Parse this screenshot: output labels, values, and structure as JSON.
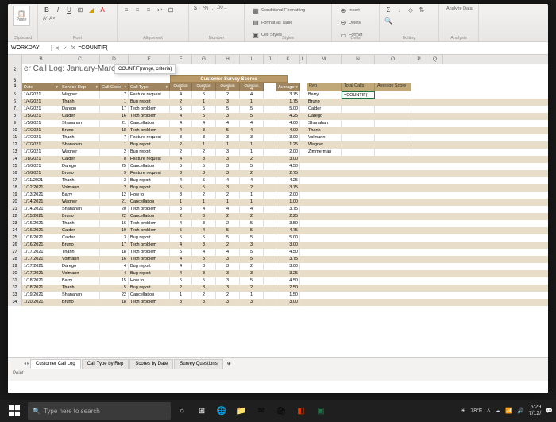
{
  "namebox": "WORKDAY",
  "formula": "=COUNTIF(",
  "tooltip": "COUNTIF(range, criteria)",
  "title": "er Call Log: January-March",
  "ribbon": {
    "groups": {
      "clipboard": "Clipboard",
      "font": "Font",
      "alignment": "Alignment",
      "number": "Number",
      "styles": "Styles",
      "cells": "Cells",
      "editing": "Editing",
      "analysis": "Analysis"
    },
    "paste": "Paste",
    "cond_fmt": "Conditional Formatting",
    "fmt_table": "Format as Table",
    "cell_styles": "Cell Styles",
    "insert": "Insert",
    "delete": "Delete",
    "format": "Format",
    "analyze": "Analyze Data"
  },
  "colheaders": [
    "B",
    "C",
    "D",
    "E",
    "F",
    "G",
    "H",
    "I",
    "J",
    "K",
    "L",
    "M",
    "N",
    "O",
    "P",
    "Q"
  ],
  "survey_header": "Customer Survey Scores",
  "table_headers": {
    "date": "Date",
    "rep": "Service Rep",
    "code": "Call Code",
    "type": "Call Type",
    "q": "Question",
    "q1": "1",
    "q2": "2",
    "q3": "3",
    "q4": "4",
    "avg": "Average"
  },
  "right_headers": {
    "rep": "Rep",
    "total": "Total Calls",
    "avg": "Average Score"
  },
  "right_formula": "=COUNTIF(",
  "reps": [
    "Barry",
    "Bruno",
    "Calder",
    "Darego",
    "Shanahan",
    "Thanh",
    "Volmann",
    "Wagner",
    "Zimmerman"
  ],
  "rows": [
    {
      "n": 5,
      "d": "1/4/2021",
      "r": "Wagner",
      "c": "7",
      "t": "Feature request",
      "q": [
        4,
        5,
        2,
        4
      ],
      "a": "3.75"
    },
    {
      "n": 6,
      "d": "1/4/2021",
      "r": "Thanh",
      "c": "1",
      "t": "Bug report",
      "q": [
        2,
        1,
        3,
        1
      ],
      "a": "1.75"
    },
    {
      "n": 7,
      "d": "1/4/2021",
      "r": "Darego",
      "c": "17",
      "t": "Tech problem",
      "q": [
        5,
        5,
        5,
        5
      ],
      "a": "5.00"
    },
    {
      "n": 8,
      "d": "1/5/2021",
      "r": "Calder",
      "c": "16",
      "t": "Tech problem",
      "q": [
        4,
        5,
        3,
        5
      ],
      "a": "4.25"
    },
    {
      "n": 9,
      "d": "1/5/2021",
      "r": "Shanahan",
      "c": "21",
      "t": "Cancellation",
      "q": [
        4,
        4,
        4,
        4
      ],
      "a": "4.00"
    },
    {
      "n": 10,
      "d": "1/7/2021",
      "r": "Bruno",
      "c": "18",
      "t": "Tech problem",
      "q": [
        4,
        3,
        5,
        4
      ],
      "a": "4.00"
    },
    {
      "n": 11,
      "d": "1/7/2021",
      "r": "Thanh",
      "c": "7",
      "t": "Feature request",
      "q": [
        3,
        3,
        3,
        3
      ],
      "a": "3.00"
    },
    {
      "n": 12,
      "d": "1/7/2021",
      "r": "Shanahan",
      "c": "1",
      "t": "Bug report",
      "q": [
        2,
        1,
        1,
        1
      ],
      "a": "1.25"
    },
    {
      "n": 13,
      "d": "1/7/2021",
      "r": "Wagner",
      "c": "2",
      "t": "Bug report",
      "q": [
        2,
        2,
        3,
        1
      ],
      "a": "2.00"
    },
    {
      "n": 14,
      "d": "1/8/2021",
      "r": "Calder",
      "c": "8",
      "t": "Feature request",
      "q": [
        4,
        3,
        3,
        2
      ],
      "a": "3.00"
    },
    {
      "n": 15,
      "d": "1/9/2021",
      "r": "Darego",
      "c": "25",
      "t": "Cancellation",
      "q": [
        5,
        5,
        3,
        5
      ],
      "a": "4.50"
    },
    {
      "n": 16,
      "d": "1/9/2021",
      "r": "Bruno",
      "c": "9",
      "t": "Feature request",
      "q": [
        3,
        3,
        3,
        2
      ],
      "a": "2.75"
    },
    {
      "n": 17,
      "d": "1/11/2021",
      "r": "Thanh",
      "c": "3",
      "t": "Bug report",
      "q": [
        4,
        5,
        4,
        4
      ],
      "a": "4.25"
    },
    {
      "n": 18,
      "d": "1/12/2021",
      "r": "Volmann",
      "c": "2",
      "t": "Bug report",
      "q": [
        5,
        5,
        3,
        2
      ],
      "a": "3.75"
    },
    {
      "n": 19,
      "d": "1/13/2021",
      "r": "Barry",
      "c": "12",
      "t": "How to",
      "q": [
        3,
        2,
        2,
        1
      ],
      "a": "2.00"
    },
    {
      "n": 20,
      "d": "1/14/2021",
      "r": "Wagner",
      "c": "21",
      "t": "Cancellation",
      "q": [
        1,
        1,
        1,
        1
      ],
      "a": "1.00"
    },
    {
      "n": 21,
      "d": "1/14/2021",
      "r": "Shanahan",
      "c": "20",
      "t": "Tech problem",
      "q": [
        3,
        4,
        4,
        4
      ],
      "a": "3.75"
    },
    {
      "n": 22,
      "d": "1/15/2021",
      "r": "Bruno",
      "c": "22",
      "t": "Cancellation",
      "q": [
        2,
        3,
        2,
        2
      ],
      "a": "2.25"
    },
    {
      "n": 23,
      "d": "1/16/2021",
      "r": "Thanh",
      "c": "16",
      "t": "Tech problem",
      "q": [
        4,
        3,
        2,
        5
      ],
      "a": "3.50"
    },
    {
      "n": 24,
      "d": "1/16/2021",
      "r": "Calder",
      "c": "19",
      "t": "Tech problem",
      "q": [
        5,
        4,
        5,
        5
      ],
      "a": "4.75"
    },
    {
      "n": 25,
      "d": "1/16/2021",
      "r": "Calder",
      "c": "3",
      "t": "Bug report",
      "q": [
        5,
        5,
        5,
        5
      ],
      "a": "5.00"
    },
    {
      "n": 26,
      "d": "1/16/2021",
      "r": "Bruno",
      "c": "17",
      "t": "Tech problem",
      "q": [
        4,
        3,
        2,
        3
      ],
      "a": "3.00"
    },
    {
      "n": 27,
      "d": "1/17/2021",
      "r": "Thanh",
      "c": "18",
      "t": "Tech problem",
      "q": [
        5,
        4,
        4,
        5
      ],
      "a": "4.50"
    },
    {
      "n": 28,
      "d": "1/17/2021",
      "r": "Volmann",
      "c": "16",
      "t": "Tech problem",
      "q": [
        4,
        3,
        3,
        5
      ],
      "a": "3.75"
    },
    {
      "n": 29,
      "d": "1/17/2021",
      "r": "Darego",
      "c": "4",
      "t": "Bug report",
      "q": [
        4,
        3,
        3,
        2
      ],
      "a": "3.00"
    },
    {
      "n": 30,
      "d": "1/17/2021",
      "r": "Volmann",
      "c": "4",
      "t": "Bug report",
      "q": [
        4,
        3,
        3,
        3
      ],
      "a": "3.25"
    },
    {
      "n": 31,
      "d": "1/18/2021",
      "r": "Barry",
      "c": "15",
      "t": "How to",
      "q": [
        5,
        5,
        3,
        5
      ],
      "a": "4.50"
    },
    {
      "n": 32,
      "d": "1/18/2021",
      "r": "Thanh",
      "c": "5",
      "t": "Bug report",
      "q": [
        2,
        3,
        3,
        2
      ],
      "a": "2.50"
    },
    {
      "n": 33,
      "d": "1/19/2021",
      "r": "Shanahan",
      "c": "22",
      "t": "Cancellation",
      "q": [
        1,
        2,
        2,
        1
      ],
      "a": "1.50"
    },
    {
      "n": 34,
      "d": "1/20/2021",
      "r": "Bruno",
      "c": "18",
      "t": "Tech problem",
      "q": [
        3,
        3,
        3,
        3
      ],
      "a": "3.00"
    }
  ],
  "sheet_tabs": [
    "Customer Call Log",
    "Call Type by Rep",
    "Scores by Date",
    "Survey Questions"
  ],
  "status": "Point",
  "taskbar": {
    "search": "Type here to search",
    "temp": "78°F",
    "time": "5:29",
    "date": "7/12/"
  }
}
